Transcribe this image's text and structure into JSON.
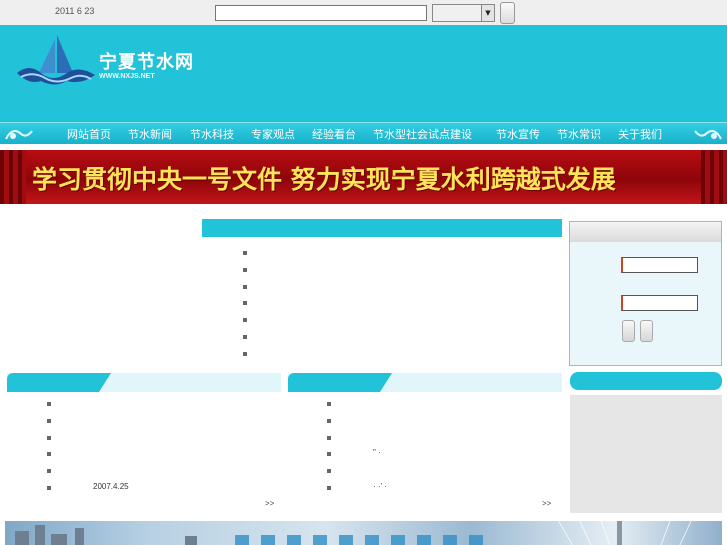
{
  "topbar": {
    "date": "2011 6 23",
    "search_value": "",
    "select_value": ""
  },
  "header": {
    "title": "宁夏节水网",
    "url": "WWW.NXJS.NET"
  },
  "nav": {
    "items": [
      "网站首页",
      "节水新闻",
      "节水科技",
      "专家观点",
      "经验看台",
      "节水型社会试点建设",
      "节水宣传",
      "节水常识",
      "关于我们"
    ]
  },
  "banner": {
    "slogan": "学习贯彻中央一号文件  努力实现宁夏水利跨越式发展"
  },
  "center_news": {
    "items": [
      "",
      "",
      "",
      "",
      "",
      "",
      ""
    ]
  },
  "col_left": {
    "items": [
      "",
      "",
      "",
      "",
      "",
      "2007.4.25"
    ],
    "more": ">>"
  },
  "col_mid": {
    "items": [
      "",
      "",
      "",
      "\" ·",
      "",
      "· ·’ ·"
    ],
    "more": ">>"
  },
  "login": {
    "username": "",
    "password": ""
  },
  "colors": {
    "accent": "#22c2d8",
    "banner_bg": "#a10c10",
    "banner_text": "#ffe35a"
  }
}
